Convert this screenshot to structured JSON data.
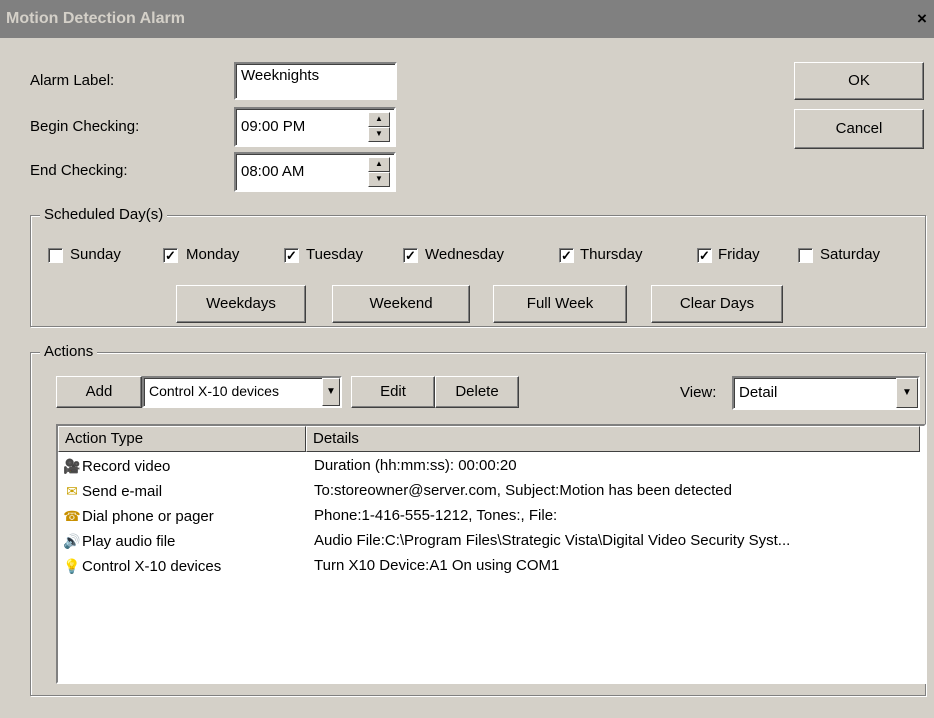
{
  "window": {
    "title": "Motion Detection Alarm",
    "close_glyph": "×"
  },
  "fields": {
    "alarm_label": {
      "label": "Alarm Label:",
      "value": "Weeknights"
    },
    "begin": {
      "label": "Begin Checking:",
      "value": "09:00 PM"
    },
    "end": {
      "label": "End Checking:",
      "value": "08:00 AM"
    }
  },
  "buttons": {
    "ok": "OK",
    "cancel": "Cancel"
  },
  "schedule": {
    "title": "Scheduled Day(s)",
    "days": [
      {
        "label": "Sunday",
        "checked": false
      },
      {
        "label": "Monday",
        "checked": true
      },
      {
        "label": "Tuesday",
        "checked": true
      },
      {
        "label": "Wednesday",
        "checked": true
      },
      {
        "label": "Thursday",
        "checked": true
      },
      {
        "label": "Friday",
        "checked": true
      },
      {
        "label": "Saturday",
        "checked": false
      }
    ],
    "buttons": {
      "weekdays": "Weekdays",
      "weekend": "Weekend",
      "full_week": "Full Week",
      "clear_days": "Clear Days"
    }
  },
  "actions": {
    "title": "Actions",
    "add": "Add",
    "action_type_select": "Control X-10 devices",
    "edit": "Edit",
    "delete": "Delete",
    "view_label": "View:",
    "view_select": "Detail",
    "columns": {
      "type": "Action Type",
      "details": "Details"
    },
    "rows": [
      {
        "icon": "video-camera-icon",
        "type": "Record video",
        "details": "Duration (hh:mm:ss): 00:00:20"
      },
      {
        "icon": "envelope-icon",
        "type": "Send e-mail",
        "details": "To:storeowner@server.com, Subject:Motion has been detected"
      },
      {
        "icon": "phone-icon",
        "type": "Dial phone or pager",
        "details": "Phone:1-416-555-1212, Tones:, File:"
      },
      {
        "icon": "speaker-icon",
        "type": "Play audio file",
        "details": "Audio File:C:\\Program Files\\Strategic Vista\\Digital Video Security Syst..."
      },
      {
        "icon": "light-bulb-icon",
        "type": "Control X-10 devices",
        "details": "Turn X10 Device:A1 On using COM1"
      }
    ]
  },
  "colors": {
    "titlebar": "#808080",
    "face": "#d4d0c8"
  }
}
